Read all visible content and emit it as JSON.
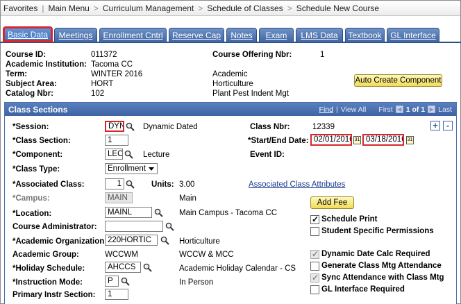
{
  "breadcrumb": [
    "Favorites",
    "Main Menu",
    "Curriculum Management",
    "Schedule of Classes",
    "Schedule New Course"
  ],
  "tabs": [
    "Basic Data",
    "Meetings",
    "Enrollment Cntrl",
    "Reserve Cap",
    "Notes",
    "Exam",
    "LMS Data",
    "Textbook",
    "GL Interface"
  ],
  "course": {
    "course_id_label": "Course ID:",
    "course_id": "011372",
    "institution_label": "Academic Institution:",
    "institution": "Tacoma CC",
    "term_label": "Term:",
    "term": "WINTER 2016",
    "term_desc": "Academic",
    "subject_label": "Subject Area:",
    "subject": "HORT",
    "subject_desc": "Horticulture",
    "catalog_label": "Catalog Nbr:",
    "catalog": "102",
    "catalog_desc": "Plant Pest Indent Mgt",
    "offering_label": "Course Offering Nbr:",
    "offering": "1",
    "auto_create_label": "Auto Create Component"
  },
  "class_sections": {
    "title": "Class Sections",
    "find": "Find",
    "view_all": "View All",
    "first": "First",
    "range": "1 of 1",
    "last": "Last",
    "add": "+",
    "remove": "-"
  },
  "fields": {
    "session_label": "*Session:",
    "session": "DYN",
    "session_desc": "Dynamic Dated",
    "class_nbr_label": "Class Nbr:",
    "class_nbr": "12339",
    "class_section_label": "*Class Section:",
    "class_section": "1",
    "start_end_label": "*Start/End Date:",
    "start_date": "02/01/2016",
    "end_date": "03/18/2016",
    "component_label": "*Component:",
    "component": "LEC",
    "component_desc": "Lecture",
    "event_id_label": "Event ID:",
    "class_type_label": "*Class Type:",
    "class_type": "Enrollment",
    "assoc_class_label": "*Associated Class:",
    "assoc_class": "1",
    "units_label": "Units:",
    "units": "3.00",
    "assoc_attrs_link": "Associated Class Attributes",
    "campus_label": "*Campus:",
    "campus": "MAIN",
    "campus_desc": "Main",
    "add_fee_label": "Add Fee",
    "location_label": "*Location:",
    "location": "MAINL",
    "location_desc": "Main Campus - Tacoma CC",
    "schedule_print_label": "Schedule Print",
    "course_admin_label": "Course Administrator:",
    "course_admin": "",
    "student_perm_label": "Student Specific Permissions",
    "acad_org_label": "*Academic Organization:",
    "acad_org": "220HORTIC",
    "acad_org_desc": "Horticulture",
    "acad_group_label": "Academic Group:",
    "acad_group": "WCCWM",
    "acad_group_desc": "WCCW & MCC",
    "dyn_date_label": "Dynamic Date Calc Required",
    "holiday_label": "*Holiday Schedule:",
    "holiday": "AHCCS",
    "holiday_desc": "Academic Holiday Calendar - CS",
    "gen_mtg_label": "Generate Class Mtg Attendance",
    "instr_mode_label": "*Instruction Mode:",
    "instr_mode": "P",
    "instr_mode_desc": "In Person",
    "sync_label": "Sync Attendance with Class Mtg",
    "primary_label": "Primary Instr Section:",
    "primary": "1",
    "gl_label": "GL Interface Required"
  },
  "checkboxes": {
    "schedule_print": true,
    "student_perm": false,
    "dyn_date": true,
    "gen_mtg": false,
    "sync": true,
    "gl": false
  },
  "colors": {
    "tab": "#3f66a4",
    "highlight": "#d9262c",
    "section_header": "#3d63a3",
    "button": "#f2dc5a"
  }
}
